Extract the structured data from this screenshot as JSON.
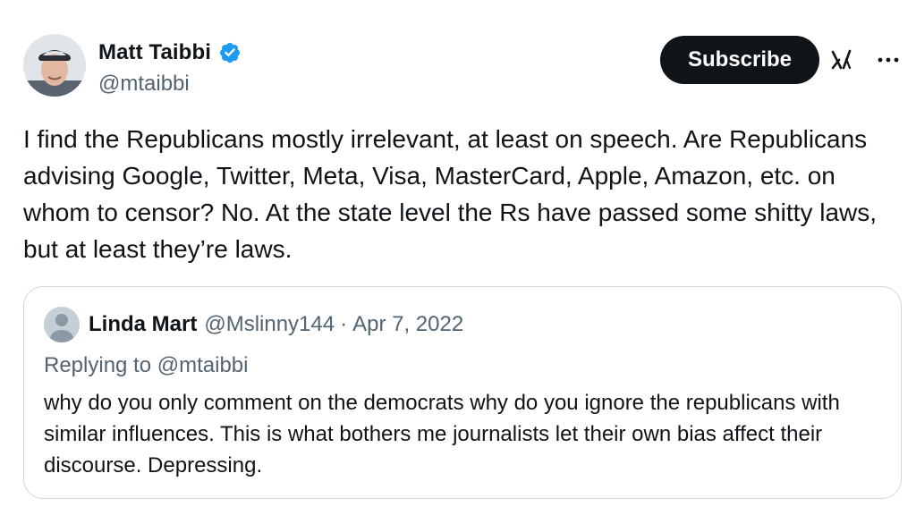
{
  "author": {
    "display_name": "Matt Taibbi",
    "handle": "@mtaibbi"
  },
  "actions": {
    "subscribe_label": "Subscribe",
    "grok_icon": "grok-icon",
    "more_icon": "more-icon"
  },
  "tweet": {
    "text": "I find the Republicans mostly irrelevant, at least on speech. Are Republicans advising Google, Twitter, Meta, Visa, MasterCard, Apple, Amazon, etc. on whom to censor? No. At the state level the Rs have passed some shitty laws, but at least they’re laws."
  },
  "quoted": {
    "display_name": "Linda Mart",
    "handle": "@Mslinny144",
    "separator": "·",
    "date": "Apr 7, 2022",
    "replying_to": "Replying to @mtaibbi",
    "text": "why do you only comment on the democrats why do you ignore the republicans with similar influences.  This is what bothers me journalists let their own bias affect their discourse. Depressing."
  },
  "colors": {
    "text_primary": "#0f1419",
    "text_secondary": "#536471",
    "verified_blue": "#1d9bf0",
    "border": "#cfd9de",
    "button_bg": "#0f1419"
  }
}
